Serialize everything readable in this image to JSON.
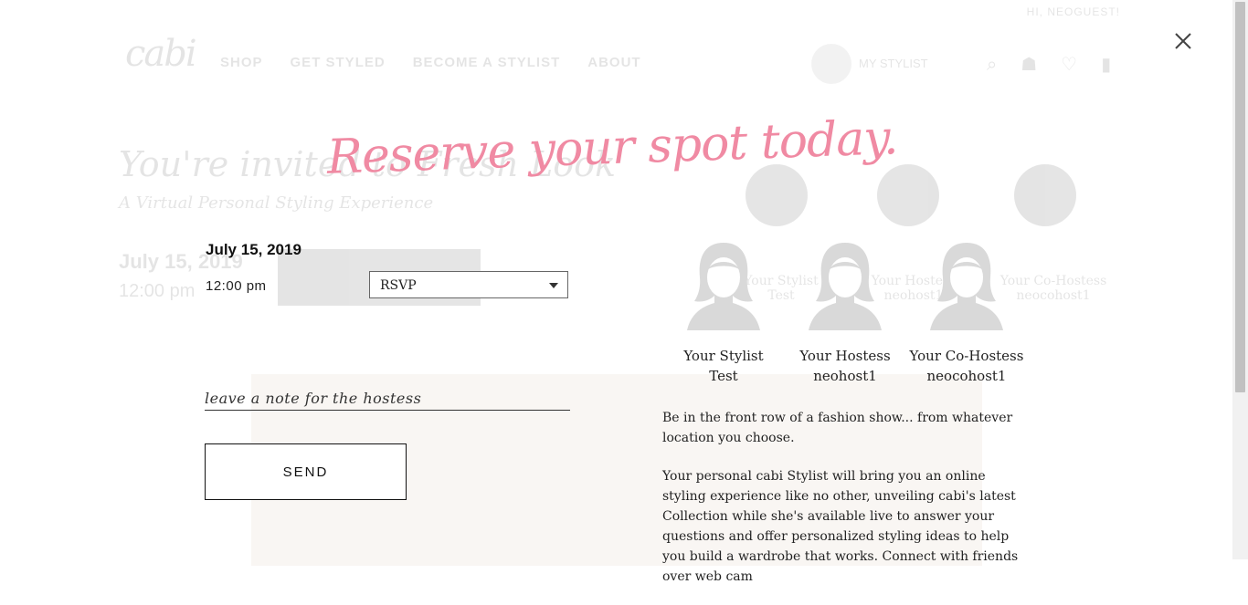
{
  "background": {
    "topbar_greeting": "HI, NEOGUEST!",
    "logo": "cabi",
    "nav": [
      "SHOP",
      "GET STYLED",
      "BECOME A STYLIST",
      "ABOUT"
    ],
    "stylist_chip": "MY STYLIST",
    "title": "You're invited to Fresh Look",
    "subtitle": "A Virtual Personal Styling Experience",
    "date": "July 15, 2019",
    "time": "12:00 pm",
    "hosts": [
      {
        "role": "Your Stylist",
        "name": "Test"
      },
      {
        "role": "Your Hostess",
        "name": "neohost1"
      },
      {
        "role": "Your Co-Hostess",
        "name": "neocohost1"
      }
    ]
  },
  "modal": {
    "close_icon": "close-icon",
    "headline": "Reserve your spot today.",
    "event_date": "July 15, 2019",
    "event_time": "12:00 pm",
    "rsvp": {
      "selected": "RSVP"
    },
    "note": {
      "placeholder": "leave a note for the hostess",
      "value": ""
    },
    "send_label": "SEND",
    "hosts": [
      {
        "role": "Your Stylist",
        "name": "Test"
      },
      {
        "role": "Your Hostess",
        "name": "neohost1"
      },
      {
        "role": "Your Co-Hostess",
        "name": "neocohost1"
      }
    ],
    "description": [
      "Be in the front row of a fashion show... from whatever location you choose.",
      "Your personal cabi Stylist will bring you an online styling experience like no other, unveiling cabi's latest Collection while she's available live to answer your questions and offer personalized styling ideas to help you build a wardrobe that works. Connect with friends over web cam"
    ]
  },
  "colors": {
    "headline": "#f08aa3",
    "avatar": "#d9d9d9"
  }
}
